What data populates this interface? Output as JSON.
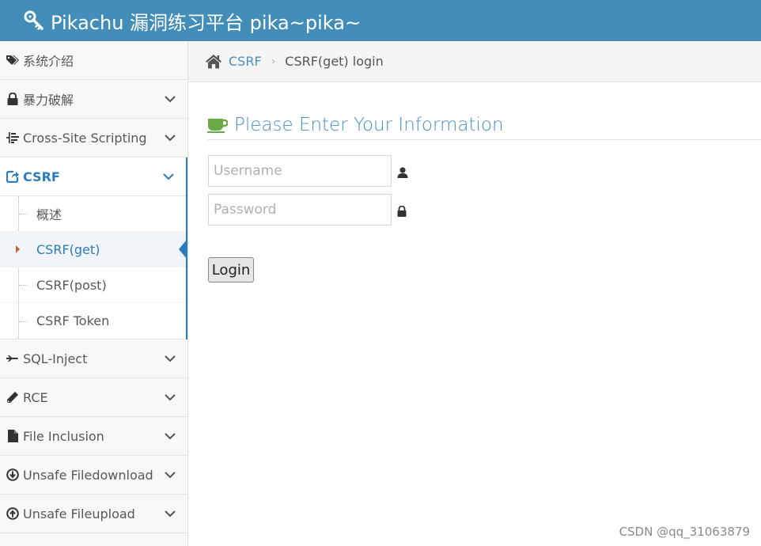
{
  "header": {
    "title": "Pikachu 漏洞练习平台 pika~pika~",
    "bg_color": "#438eb9",
    "icon": "key-icon"
  },
  "breadcrumb": {
    "home_icon": "home-icon",
    "parent": "CSRF",
    "separator": "›",
    "current": "CSRF(get) login"
  },
  "sidebar": {
    "items": [
      {
        "label": "系统介绍",
        "icon": "tags-icon"
      },
      {
        "label": "暴力破解",
        "icon": "lock-icon"
      },
      {
        "label": "Cross-Site Scripting",
        "icon": "list-icon"
      },
      {
        "label": "CSRF",
        "icon": "share-icon"
      },
      {
        "label": "SQL-Inject",
        "icon": "plane-icon"
      },
      {
        "label": "RCE",
        "icon": "pencil-icon"
      },
      {
        "label": "File Inclusion",
        "icon": "file-icon"
      },
      {
        "label": "Unsafe Filedownload",
        "icon": "download-icon"
      },
      {
        "label": "Unsafe Fileupload",
        "icon": "upload-icon"
      }
    ],
    "csrf_subitems": [
      {
        "label": "概述"
      },
      {
        "label": "CSRF(get)"
      },
      {
        "label": "CSRF(post)"
      },
      {
        "label": "CSRF Token"
      }
    ],
    "active_color": "#2b7dbc"
  },
  "form": {
    "heading": "Please Enter Your Information",
    "heading_icon": "coffee-icon",
    "username_placeholder": "Username",
    "password_placeholder": "Password",
    "login_label": "Login"
  },
  "watermark": "CSDN @qq_31063879"
}
